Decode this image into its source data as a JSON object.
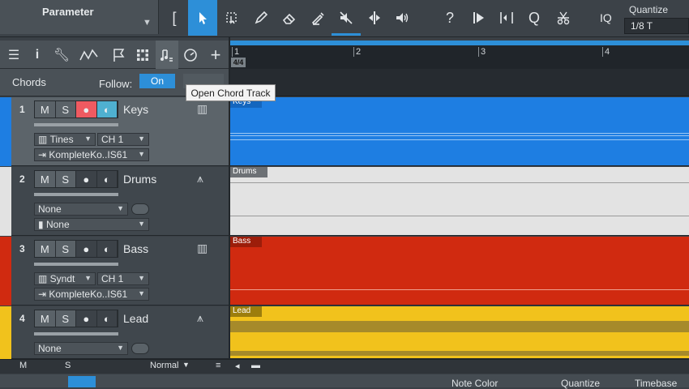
{
  "toolbar": {
    "parameter_label": "Parameter",
    "iq_label": "IQ",
    "quantize_label": "Quantize",
    "quantize_value": "1/8 T",
    "tools": [
      "bracket-icon",
      "arrow-icon",
      "range-icon",
      "pencil-icon",
      "eraser-icon",
      "paint-icon",
      "mute-icon",
      "split-icon",
      "listen-icon",
      "help-icon",
      "play-icon",
      "bend-icon",
      "q-icon",
      "scissors-icon"
    ],
    "selected_tool": "arrow-icon",
    "colors": {
      "accent": "#2d8fd8"
    }
  },
  "track_header_tools": [
    "menu-icon",
    "info-icon",
    "wrench-icon",
    "automation-icon",
    "flag-icon",
    "grid-icon",
    "chord-icon",
    "clock-icon",
    "plus-icon"
  ],
  "chords": {
    "label": "Chords",
    "follow_label": "Follow:",
    "follow_button": "On"
  },
  "tooltip": "Open Chord Track",
  "ruler": {
    "time_signature": "4/4",
    "bars": [
      "1",
      "2",
      "3",
      "4"
    ]
  },
  "tracks": [
    {
      "number": "1",
      "name": "Keys",
      "m": "M",
      "s": "S",
      "instrument": "Tines",
      "channel": "CH 1",
      "input": "KompleteKo..IS61",
      "lane_label": "Keys",
      "color": "#1e7ee2",
      "selected": true
    },
    {
      "number": "2",
      "name": "Drums",
      "m": "M",
      "s": "S",
      "input_none": "None",
      "output_none": "None",
      "lane_label": "Drums",
      "color": "#e2e2e2"
    },
    {
      "number": "3",
      "name": "Bass",
      "m": "M",
      "s": "S",
      "instrument": "Syndt",
      "channel": "CH 1",
      "input": "KompleteKo..IS61",
      "lane_label": "Bass",
      "color": "#d02a10"
    },
    {
      "number": "4",
      "name": "Lead",
      "m": "M",
      "s": "S",
      "input_none": "None",
      "lane_label": "Lead",
      "color": "#f1c21c"
    }
  ],
  "footer": {
    "m": "M",
    "s": "S",
    "mode": "Normal"
  },
  "bottom_panel": {
    "note_color": "Note Color",
    "quantize": "Quantize",
    "timebase": "Timebase"
  }
}
